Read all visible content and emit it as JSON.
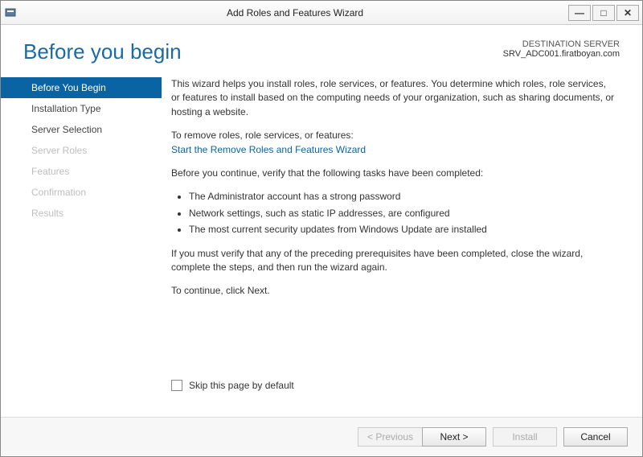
{
  "window": {
    "title": "Add Roles and Features Wizard"
  },
  "header": {
    "title": "Before you begin",
    "dest_label": "DESTINATION SERVER",
    "dest_server": "SRV_ADC001.firatboyan.com"
  },
  "sidebar": {
    "items": [
      {
        "label": "Before You Begin",
        "state": "active"
      },
      {
        "label": "Installation Type",
        "state": "normal"
      },
      {
        "label": "Server Selection",
        "state": "normal"
      },
      {
        "label": "Server Roles",
        "state": "disabled"
      },
      {
        "label": "Features",
        "state": "disabled"
      },
      {
        "label": "Confirmation",
        "state": "disabled"
      },
      {
        "label": "Results",
        "state": "disabled"
      }
    ]
  },
  "content": {
    "intro": "This wizard helps you install roles, role services, or features. You determine which roles, role services, or features to install based on the computing needs of your organization, such as sharing documents, or hosting a website.",
    "remove_label": "To remove roles, role services, or features:",
    "remove_link": "Start the Remove Roles and Features Wizard",
    "verify_intro": "Before you continue, verify that the following tasks have been completed:",
    "bullets": [
      "The Administrator account has a strong password",
      "Network settings, such as static IP addresses, are configured",
      "The most current security updates from Windows Update are installed"
    ],
    "verify_note": "If you must verify that any of the preceding prerequisites have been completed, close the wizard, complete the steps, and then run the wizard again.",
    "continue_hint": "To continue, click Next.",
    "skip_label": "Skip this page by default"
  },
  "footer": {
    "prev": "< Previous",
    "next": "Next >",
    "install": "Install",
    "cancel": "Cancel"
  }
}
